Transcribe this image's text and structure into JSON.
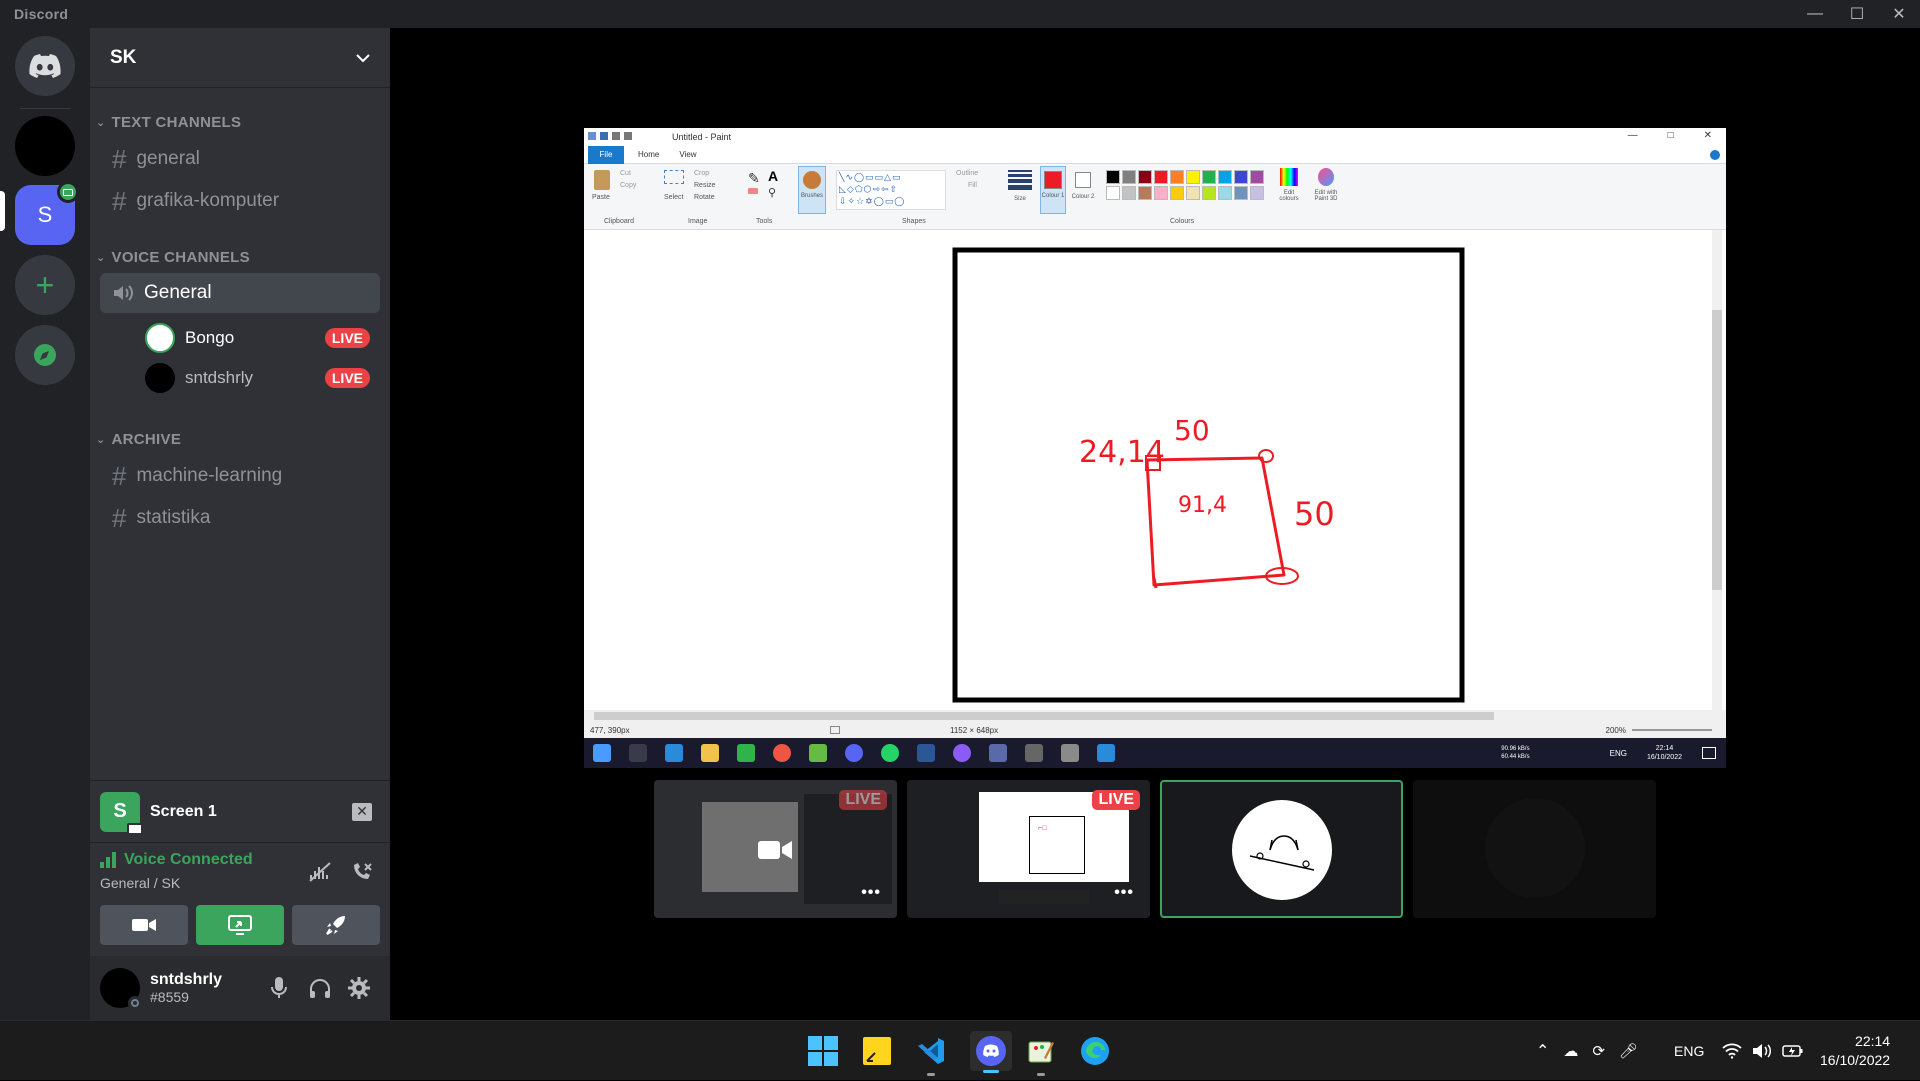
{
  "titlebar": {
    "app": "Discord"
  },
  "server": {
    "name": "SK",
    "icon_letter": "S"
  },
  "categories": {
    "text": "TEXT CHANNELS",
    "voice": "VOICE CHANNELS",
    "archive": "ARCHIVE"
  },
  "text_channels": [
    "general",
    "grafika-komputer"
  ],
  "voice_channel": {
    "name": "General",
    "users": [
      {
        "name": "Bongo",
        "badge": "LIVE"
      },
      {
        "name": "sntdshrly",
        "badge": "LIVE"
      }
    ]
  },
  "archive_channels": [
    "machine-learning",
    "statistika"
  ],
  "screen_share": {
    "label": "Screen 1",
    "icon_letter": "S"
  },
  "voice_status": {
    "title": "Voice Connected",
    "location": "General / SK"
  },
  "user": {
    "name": "sntdshrly",
    "tag": "#8559"
  },
  "paint": {
    "title": "Untitled - Paint",
    "tabs": {
      "file": "File",
      "home": "Home",
      "view": "View"
    },
    "groups": {
      "clipboard": "Clipboard",
      "image": "Image",
      "tools": "Tools",
      "shapes": "Shapes",
      "colours": "Colours"
    },
    "tools": {
      "paste": "Paste",
      "cut": "Cut",
      "copy": "Copy",
      "select": "Select",
      "crop": "Crop",
      "resize": "Resize",
      "rotate": "Rotate",
      "brushes": "Brushes",
      "outline": "Outline",
      "fill": "Fill",
      "size": "Size",
      "colour1": "Colour 1",
      "colour2": "Colour 2",
      "edit_colours": "Edit colours",
      "paint3d": "Edit with Paint 3D"
    },
    "drawing": {
      "label_top": "24,14",
      "label_top2": "50",
      "label_right": "50",
      "label_center": "91,4"
    },
    "status": {
      "cursor": "477, 390px",
      "size": "1152 × 648px",
      "zoom": "200%"
    },
    "inner_tray": {
      "lang": "ENG",
      "up": "90.96 kB/s",
      "down": "60.44 kB/s",
      "time": "22:14",
      "date": "16/10/2022"
    },
    "palette": [
      "#000000",
      "#7f7f7f",
      "#880015",
      "#ed1c24",
      "#ff7f27",
      "#fff200",
      "#22b14c",
      "#00a2e8",
      "#3f48cc",
      "#a349a4",
      "#ffffff",
      "#c3c3c3",
      "#b97a57",
      "#ffaec9",
      "#ffc90e",
      "#efe4b0",
      "#b5e61d",
      "#99d9ea",
      "#7092be",
      "#c8bfe7"
    ]
  },
  "thumbs": {
    "badge": "LIVE"
  },
  "taskbar": {
    "lang": "ENG",
    "time": "22:14",
    "date": "16/10/2022"
  },
  "colors": {
    "blurple": "#5865f2",
    "green": "#3ba55d",
    "red": "#ed4245",
    "paint_red": "#ed1c24"
  }
}
